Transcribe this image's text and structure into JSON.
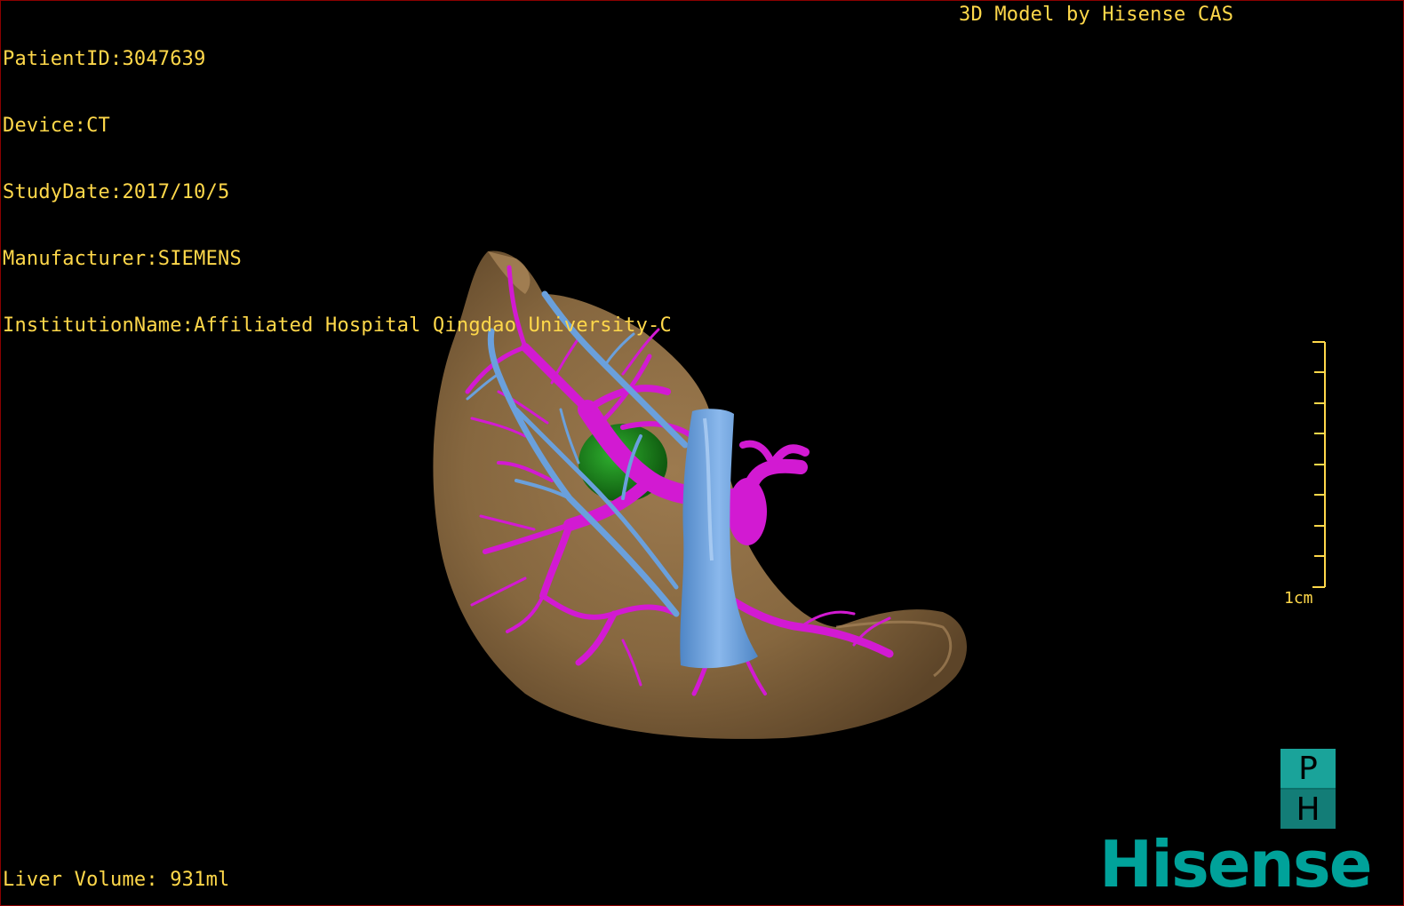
{
  "header": {
    "patient_id": "PatientID:3047639",
    "device": "Device:CT",
    "study_date": "StudyDate:2017/10/5",
    "manufacturer": "Manufacturer:SIEMENS",
    "institution": "InstitutionName:Affiliated Hospital Qingdao University-C",
    "credit": "3D Model by Hisense CAS"
  },
  "footer": {
    "liver_volume": "Liver Volume: 931ml"
  },
  "scale_bar": {
    "label": "1cm"
  },
  "orientation_cube": {
    "top_letter": "P",
    "bottom_letter": "H"
  },
  "brand": {
    "logo_text": "Hisense"
  },
  "colors": {
    "overlay_text": "#ffd84a",
    "liver": "#8a6a44",
    "portal_vein": "#d21ad2",
    "hepatic_vein": "#6aa0dc",
    "tumor": "#1e8a1e",
    "brand": "#00a29a",
    "border": "#8b0000"
  }
}
